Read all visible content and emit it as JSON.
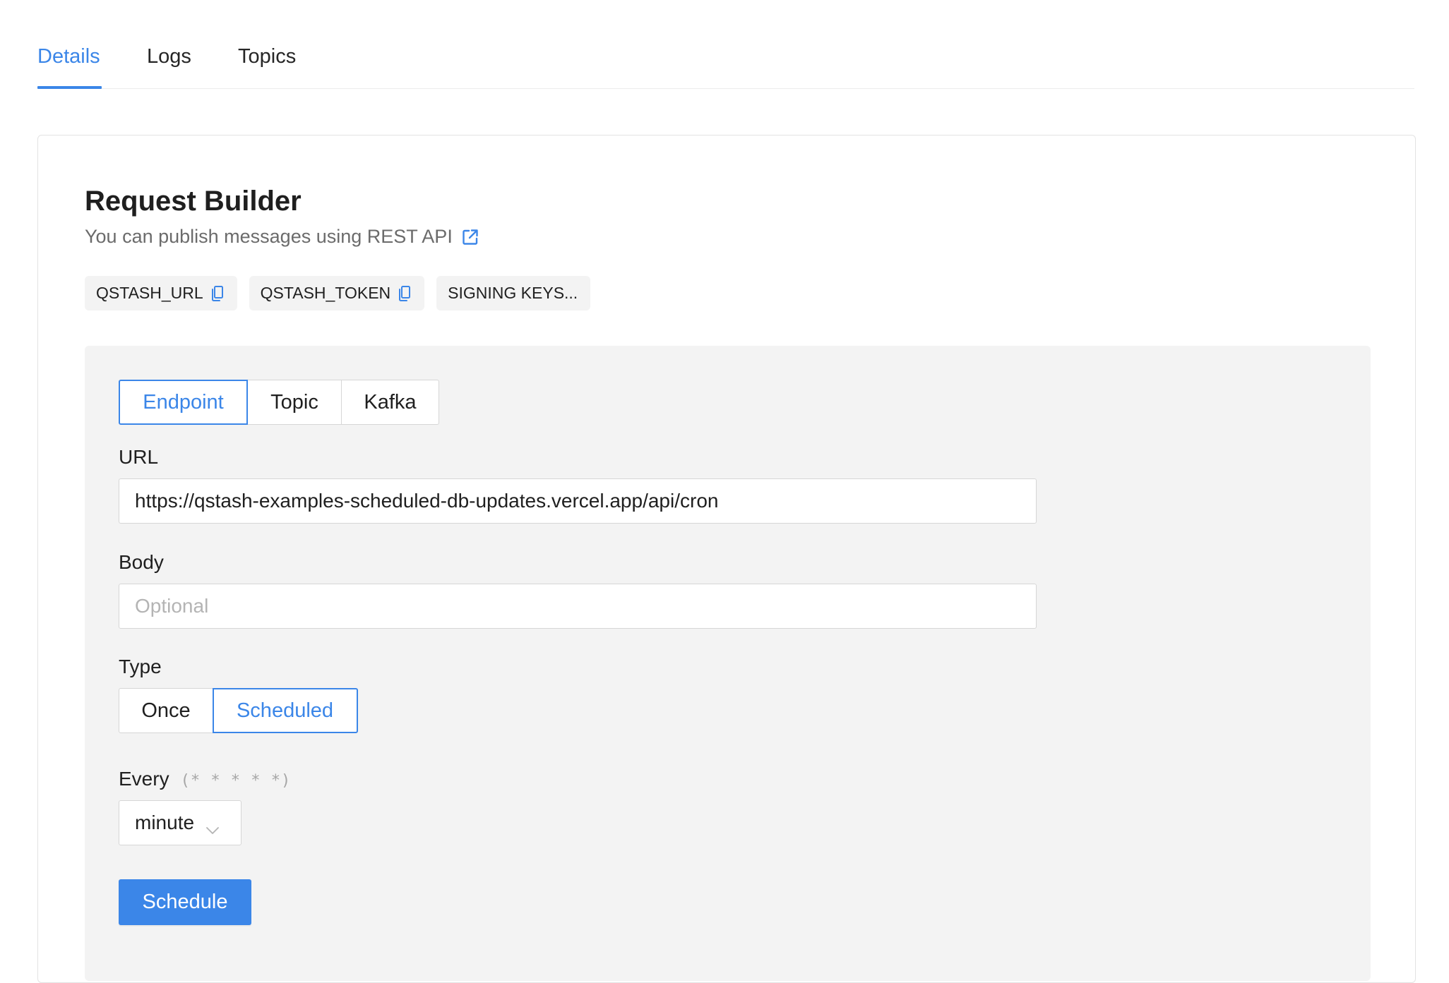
{
  "tabs": [
    {
      "label": "Details",
      "active": true
    },
    {
      "label": "Logs",
      "active": false
    },
    {
      "label": "Topics",
      "active": false
    }
  ],
  "request_builder": {
    "title": "Request Builder",
    "subtitle": "You can publish messages using REST API",
    "subtitle_link_icon": "external-link-icon",
    "chips": [
      {
        "label": "QSTASH_URL",
        "icon": "copy-icon"
      },
      {
        "label": "QSTASH_TOKEN",
        "icon": "copy-icon"
      },
      {
        "label": "SIGNING KEYS..."
      }
    ]
  },
  "destination": {
    "options": [
      "Endpoint",
      "Topic",
      "Kafka"
    ],
    "selected": "Endpoint"
  },
  "url": {
    "label": "URL",
    "value": "https://qstash-examples-scheduled-db-updates.vercel.app/api/cron"
  },
  "body": {
    "label": "Body",
    "placeholder": "Optional",
    "value": ""
  },
  "type": {
    "label": "Type",
    "options": [
      "Once",
      "Scheduled"
    ],
    "selected": "Scheduled"
  },
  "every": {
    "label": "Every",
    "hint": "(* * * * *)",
    "selected_value": "minute",
    "icon": "chevron-down-icon"
  },
  "actions": {
    "submit_label": "Schedule"
  },
  "colors": {
    "accent": "#3b86e8",
    "panel_bg": "#f3f3f3",
    "chip_bg": "#f3f3f3",
    "border": "#d6d6d6",
    "muted_text": "#6b6b6b"
  }
}
